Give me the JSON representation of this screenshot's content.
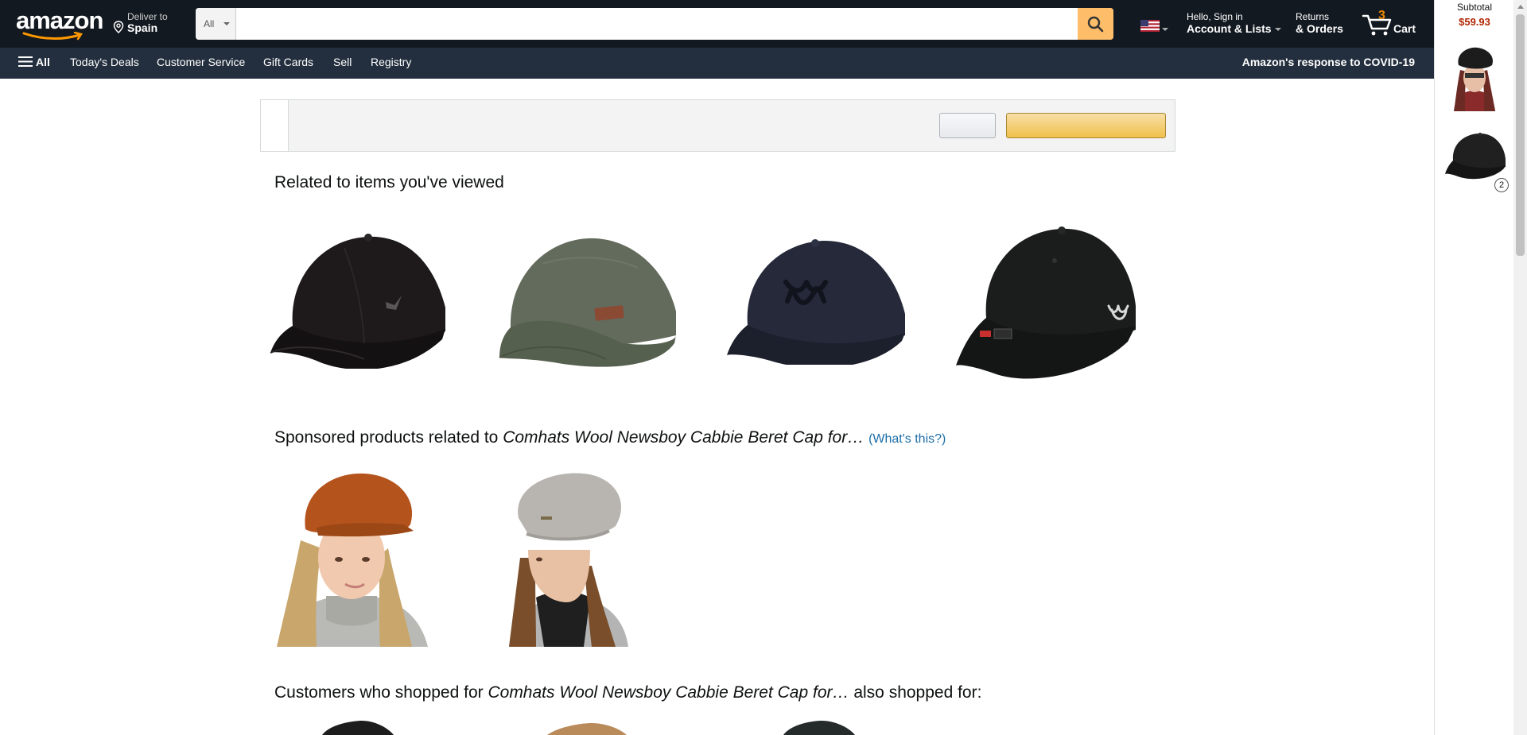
{
  "header": {
    "logo_text": "amazon",
    "deliver_line1": "Deliver to",
    "deliver_line2": "Spain",
    "search_category": "All",
    "search_placeholder": "",
    "account_line1": "Hello, Sign in",
    "account_line2": "Account & Lists",
    "returns_line1": "Returns",
    "returns_line2": "& Orders",
    "cart_count": "3",
    "cart_label": "Cart"
  },
  "subnav": {
    "all_label": "All",
    "items": [
      "Today's Deals",
      "Customer Service",
      "Gift Cards",
      "Sell",
      "Registry"
    ],
    "covid_label": "Amazon's response to COVID-19"
  },
  "sections": {
    "related_title": "Related to items you've viewed",
    "sponsored_prefix": "Sponsored products related to ",
    "sponsored_item": "Comhats Wool Newsboy Cabbie Beret Cap for…",
    "whats_this": "(What's this?)",
    "shopped_prefix": "Customers who shopped for ",
    "shopped_item": "Comhats Wool Newsboy Cabbie Beret Cap for…",
    "shopped_suffix": " also shopped for:"
  },
  "products": {
    "related": [
      {
        "icon": "black-baseball-cap-image"
      },
      {
        "icon": "olive-baseball-cap-image"
      },
      {
        "icon": "navy-under-armour-cap-image"
      },
      {
        "icon": "black-under-armour-cap-image"
      }
    ],
    "sponsored": [
      {
        "icon": "rust-newsboy-cap-model-image"
      },
      {
        "icon": "grey-beret-model-image"
      }
    ]
  },
  "cart_rail": {
    "subtotal_label": "Subtotal",
    "subtotal_value": "$59.93",
    "second_item_qty": "2"
  },
  "colors": {
    "nav_dark": "#131921",
    "nav_sub": "#232f3e",
    "search_button": "#febd69",
    "price_red": "#b12704",
    "link_blue": "#1d6ea8",
    "cart_count_orange": "#f08804"
  }
}
